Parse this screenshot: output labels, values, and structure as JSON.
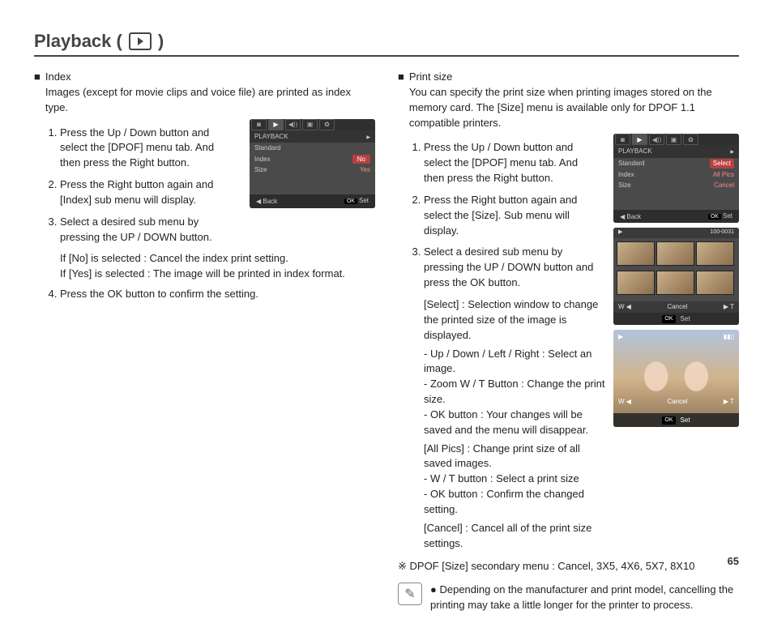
{
  "page": {
    "title_text": "Playback (",
    "title_close": ")",
    "number": "65"
  },
  "left": {
    "heading": "Index",
    "intro": "Images (except for movie clips and voice file) are printed as index type.",
    "steps": [
      "Press the Up / Down button and select the [DPOF] menu tab. And then press the Right button.",
      "Press the Right button again and [Index] sub menu will display.",
      "Select a desired sub menu by pressing the UP / DOWN button.",
      "Press the OK button to confirm the setting."
    ],
    "sub_if_no": "If [No] is selected   : Cancel the index print setting.",
    "sub_if_yes": "If [Yes] is selected  : The image will be printed in index format.",
    "lcd": {
      "header": "PLAYBACK",
      "rows": [
        {
          "label": "Standard",
          "value": ""
        },
        {
          "label": "Index",
          "value": "No"
        },
        {
          "label": "Size",
          "value": "Yes"
        }
      ],
      "footer_left_prefix": "◀",
      "footer_left": "Back",
      "footer_right": "Set"
    }
  },
  "right": {
    "heading": "Print size",
    "intro": "You can specify the print size when printing images stored on the memory card. The [Size] menu is available only for DPOF 1.1 compatible printers.",
    "steps": [
      "Press the Up / Down button and select the [DPOF] menu tab. And then press the Right button.",
      "Press the Right button again and select the [Size]. Sub menu will display.",
      "Select a desired sub menu by pressing the UP / DOWN button and press the OK button."
    ],
    "select_line": "[Select] : Selection window to change the printed size of the image is displayed.",
    "bullets": [
      "- Up / Down / Left / Right : Select an image.",
      "- Zoom W / T Button : Change the print size.",
      "- OK button : Your changes will be saved and the menu will disappear."
    ],
    "allpics_line": "[All Pics] : Change print size of all saved images.",
    "bullets2": [
      "- W / T button : Select a print size",
      "- OK button : Confirm the changed setting."
    ],
    "cancel_line": "[Cancel] : Cancel all of the print size settings.",
    "secondary_menu": "DPOF [Size] secondary menu : Cancel, 3X5, 4X6, 5X7, 8X10",
    "note": "Depending on the manufacturer and print model, cancelling the printing may take a little longer for the printer to process.",
    "lcd1": {
      "header": "PLAYBACK",
      "rows": [
        {
          "label": "Standard",
          "value": "Select"
        },
        {
          "label": "Index",
          "value": "All Pics"
        },
        {
          "label": "Size",
          "value": "Cancel"
        }
      ],
      "footer_left_prefix": "◀",
      "footer_left": "Back",
      "footer_right": "Set"
    },
    "lcd2": {
      "top_left_icon": "▶",
      "top_right": "100-0031",
      "w_label": "W ◀",
      "t_label": "▶ T",
      "cancel": "Cancel",
      "set": "Set"
    },
    "lcd3": {
      "top_left_icon": "▶",
      "w_label": "W ◀",
      "t_label": "▶ T",
      "cancel": "Cancel",
      "set": "Set"
    }
  }
}
